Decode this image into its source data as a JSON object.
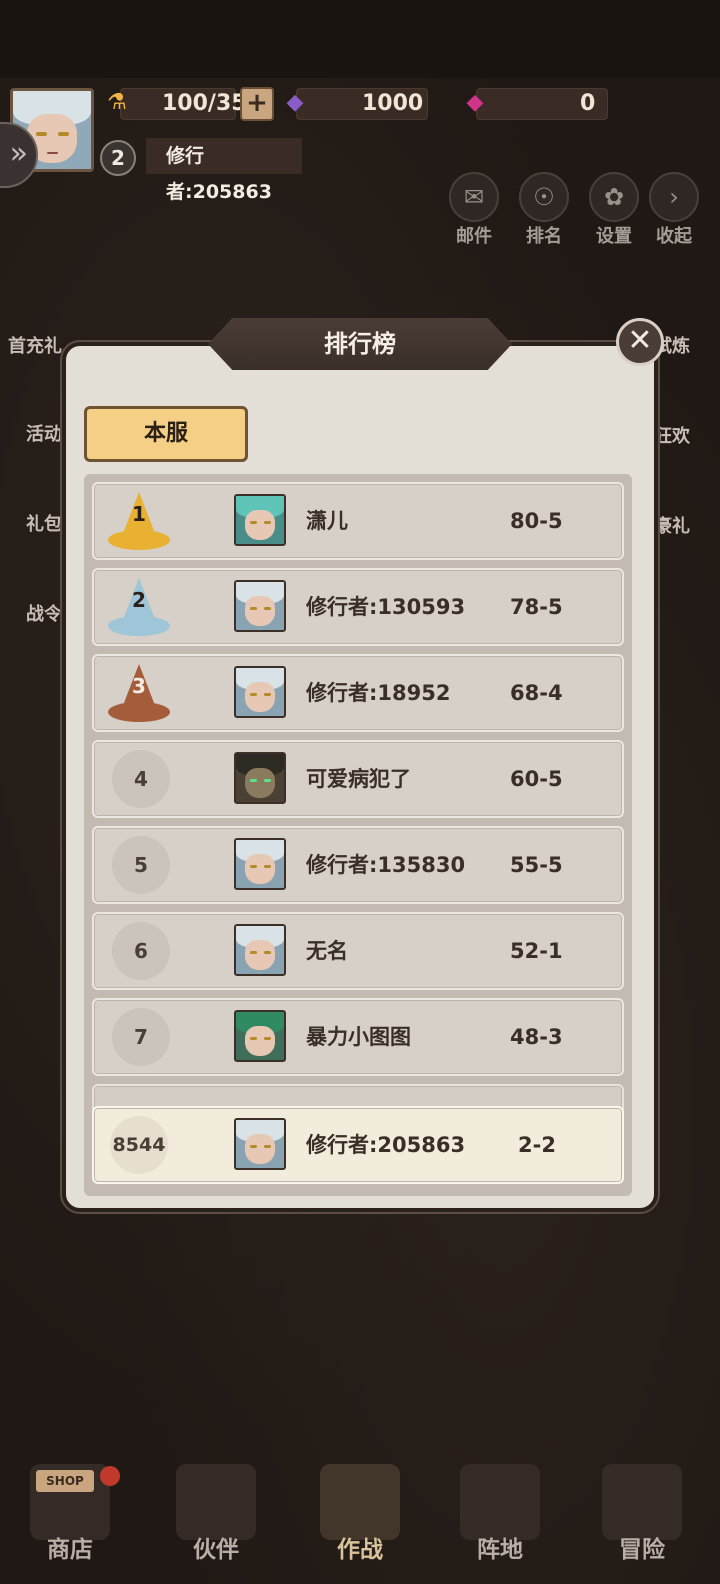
{
  "header": {
    "stamina": "100/35",
    "plus_label": "+",
    "gems": "1000",
    "tickets": "0",
    "level": "2",
    "player_name": "修行者:205863"
  },
  "top_buttons": [
    {
      "label": "邮件",
      "icon": "mail-icon"
    },
    {
      "label": "排名",
      "icon": "medal-icon"
    },
    {
      "label": "设置",
      "icon": "gear-icon"
    },
    {
      "label": "收起",
      "icon": "chevron-right-icon"
    }
  ],
  "side_left": [
    "首充礼",
    "活动",
    "礼包",
    "战令"
  ],
  "side_right": [
    "试炼",
    "狂欢",
    "豪礼"
  ],
  "modal": {
    "title": "排行榜",
    "close_glyph": "✕",
    "tab": "本服",
    "rows": [
      {
        "rank": "1",
        "name": "潇儿",
        "score": "80-5"
      },
      {
        "rank": "2",
        "name": "修行者:130593",
        "score": "78-5"
      },
      {
        "rank": "3",
        "name": "修行者:18952",
        "score": "68-4"
      },
      {
        "rank": "4",
        "name": "可爱病犯了",
        "score": "60-5"
      },
      {
        "rank": "5",
        "name": "修行者:135830",
        "score": "55-5"
      },
      {
        "rank": "6",
        "name": "无名",
        "score": "52-1"
      },
      {
        "rank": "7",
        "name": "暴力小图图",
        "score": "48-3"
      }
    ],
    "self_row": {
      "rank": "8544",
      "name": "修行者:205863",
      "score": "2-2"
    }
  },
  "bottom_nav": [
    {
      "label": "商店",
      "sign": "SHOP"
    },
    {
      "label": "伙伴"
    },
    {
      "label": "作战",
      "active": true
    },
    {
      "label": "阵地"
    },
    {
      "label": "冒险"
    }
  ]
}
